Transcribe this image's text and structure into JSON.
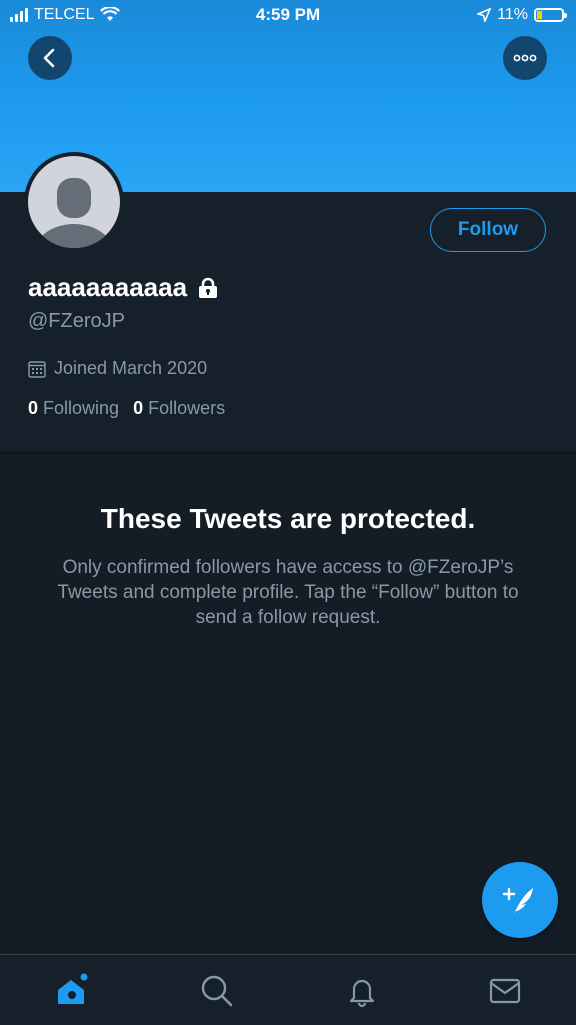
{
  "status_bar": {
    "carrier": "TELCEL",
    "time": "4:59 PM",
    "battery": "11%"
  },
  "profile": {
    "display_name": "aaaaaaaaaaa",
    "handle": "@FZeroJP",
    "joined": "Joined March 2020",
    "following_count": "0",
    "following_label": "Following",
    "followers_count": "0",
    "followers_label": "Followers",
    "follow_button": "Follow"
  },
  "protected": {
    "title": "These Tweets are protected.",
    "message": "Only confirmed followers have access to @FZeroJP’s Tweets and complete profile. Tap the “Follow” button to send a follow request."
  },
  "tab_bar": {
    "items": [
      {
        "icon": "home-icon",
        "active": true
      },
      {
        "icon": "search-icon",
        "active": false
      },
      {
        "icon": "bell-icon",
        "active": false
      },
      {
        "icon": "mail-icon",
        "active": false
      }
    ]
  },
  "colors": {
    "accent": "#1d9bf0",
    "background": "#15202b",
    "secondary_text": "#8899a6"
  }
}
